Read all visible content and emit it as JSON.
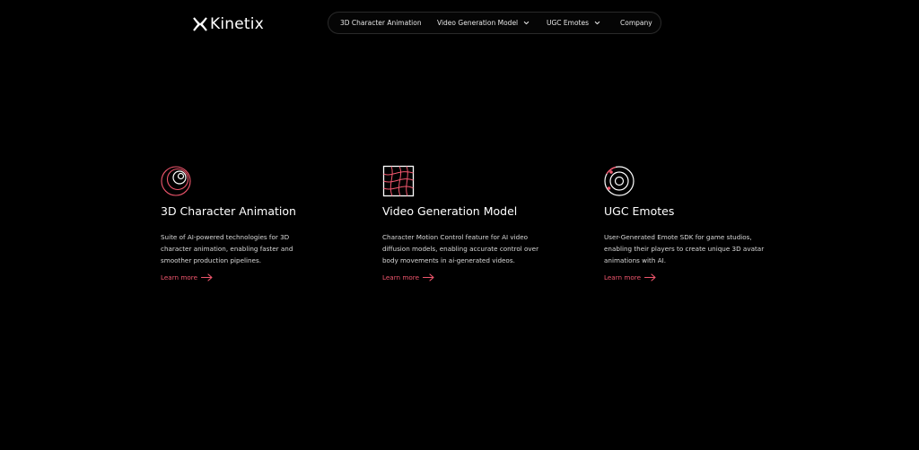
{
  "brand": {
    "name": "Kinetix",
    "logo_icon": "kinetix-x-mark-icon"
  },
  "nav": {
    "items": [
      {
        "label": "3D Character Animation",
        "has_dropdown": false
      },
      {
        "label": "Video Generation Model",
        "has_dropdown": true,
        "icon": "chevron-down-icon"
      },
      {
        "label": "UGC Emotes",
        "has_dropdown": true,
        "icon": "chevron-down-icon"
      },
      {
        "label": "Company",
        "has_dropdown": false
      }
    ]
  },
  "products": [
    {
      "icon": "spiral-eye-icon",
      "title": "3D Character Animation",
      "description_lines": [
        "Suite of AI-powered technologies for 3D",
        "character animation, enabling faster and",
        "smoother production pipelines."
      ],
      "link_label": "Learn more",
      "link_icon": "arrow-right-icon"
    },
    {
      "icon": "warped-grid-icon",
      "title": "Video Generation Model",
      "description_lines": [
        "Character Motion Control feature for AI video",
        "diffusion models, enabling accurate control over",
        "body movements in ai-generated videos."
      ],
      "link_label": "Learn more",
      "link_icon": "arrow-right-icon"
    },
    {
      "icon": "orbit-circles-icon",
      "title": "UGC Emotes",
      "description_lines": [
        "User-Generated Emote SDK for game studios,",
        "enabling their players to create unique 3D avatar",
        "animations with AI."
      ],
      "link_label": "Learn more",
      "link_icon": "arrow-right-icon"
    }
  ],
  "colors": {
    "background": "#000000",
    "accent": "#f0566d",
    "text": "#ffffff",
    "nav_border": "#2a2a2a"
  }
}
